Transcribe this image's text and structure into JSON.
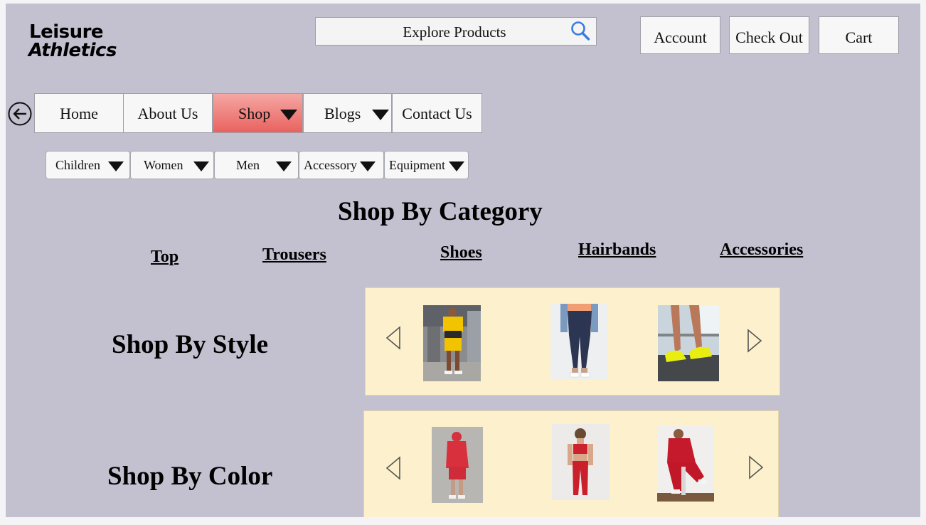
{
  "logo": {
    "line1": "Leisure",
    "line2": "Athletics"
  },
  "search": {
    "placeholder": "Explore Products",
    "icon": "search-icon"
  },
  "header_buttons": {
    "account": "Account",
    "checkout": "Check Out",
    "cart": "Cart"
  },
  "nav": {
    "back_icon": "back-arrow-icon",
    "items": [
      {
        "label": "Home"
      },
      {
        "label": "About Us"
      },
      {
        "label": "Shop",
        "active": true
      },
      {
        "label": "Blogs"
      },
      {
        "label": "Contact Us"
      }
    ]
  },
  "subnav": {
    "items": [
      {
        "label": "Children"
      },
      {
        "label": "Women"
      },
      {
        "label": "Men"
      },
      {
        "label": "Accessory"
      },
      {
        "label": "Equipment"
      }
    ]
  },
  "category": {
    "title": "Shop By Category",
    "links": [
      "Top",
      "Trousers",
      "Shoes",
      "Hairbands",
      "Accessories"
    ]
  },
  "style_section": {
    "title": "Shop By Style",
    "products": [
      "yellow-tshirt-shorts-set",
      "navy-leggings",
      "yellow-running-shoes"
    ]
  },
  "color_section": {
    "title": "Shop By Color",
    "products": [
      "red-hoodie-shorts",
      "red-sports-bra-leggings",
      "red-sweatsuit"
    ]
  },
  "colors": {
    "page_bg": "#c3c0cf",
    "carousel_bg": "#fdf1cd",
    "active_tab": "#e9625f",
    "search_icon": "#3b7be0"
  }
}
